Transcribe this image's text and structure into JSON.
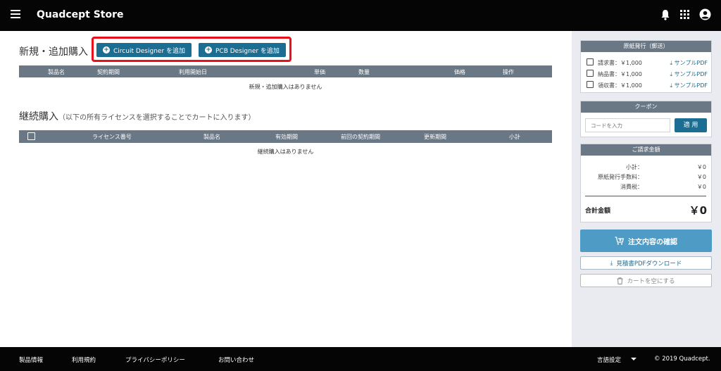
{
  "header": {
    "brand": "Quadcept Store"
  },
  "new_purchase": {
    "title": "新規・追加購入",
    "add_circuit_label": "Circuit Designer を追加",
    "add_pcb_label": "PCB Designer を追加",
    "columns": [
      "製品名",
      "契約期間",
      "利用開始日",
      "単価",
      "数量",
      "価格",
      "操作"
    ],
    "empty_message": "新規・追加購入はありません"
  },
  "renewal": {
    "title": "継続購入",
    "subtitle": "（以下の所有ライセンスを選択することでカートに入ります）",
    "columns": [
      "ライセンス番号",
      "製品名",
      "有効期間",
      "前回の契約期間",
      "更新期間",
      "小計"
    ],
    "empty_message": "継続購入はありません"
  },
  "paper_docs": {
    "title": "原紙発行（郵送）",
    "items": [
      {
        "label": "請求書：￥1,000",
        "link": "サンプルPDF"
      },
      {
        "label": "納品書：￥1,000",
        "link": "サンプルPDF"
      },
      {
        "label": "領収書：￥1,000",
        "link": "サンプルPDF"
      }
    ]
  },
  "coupon": {
    "title": "クーポン",
    "placeholder": "コードを入力",
    "apply_label": "適 用"
  },
  "billing": {
    "title": "ご請求金額",
    "rows": [
      {
        "label": "小計：",
        "value": "￥0"
      },
      {
        "label": "原紙発行手数料：",
        "value": "￥0"
      },
      {
        "label": "消費税：",
        "value": "￥0"
      }
    ],
    "total_label": "合計金額",
    "total_value": "￥0"
  },
  "actions": {
    "confirm_label": "注文内容の確認",
    "pdf_label": "見積書PDFダウンロード",
    "clear_label": "カートを空にする"
  },
  "footer": {
    "links": [
      "製品情報",
      "利用規約",
      "プライバシーポリシー",
      "お問い合わせ"
    ],
    "language_label": "言語設定",
    "copyright": "© 2019 Quadcept."
  },
  "colors": {
    "topbar": "#050505",
    "table_header": "#6a7785",
    "primary_button": "#1c6d92",
    "confirm_button": "#4e9bc6",
    "highlight": "#e8101a",
    "sidebar_bg": "#eaebf0"
  }
}
